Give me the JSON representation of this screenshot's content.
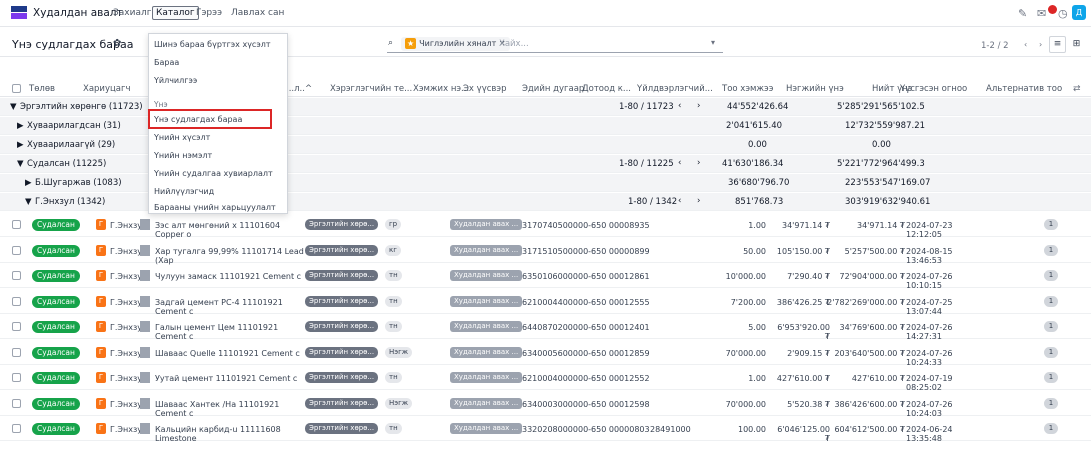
{
  "topbar": {
    "app_name": "Худалдан авалт",
    "menus": [
      "Захиалга",
      "Каталог",
      "Гэрээ",
      "Лавлах сан"
    ],
    "icons": [
      "edit-icon",
      "chat-icon",
      "clock-icon"
    ],
    "user_initial": "Д"
  },
  "subbar": {
    "title": "Үнэ судлагдах бараа",
    "gear": "✿",
    "search_chip": "Чиглэлийн хяналт",
    "search_placeholder": "Хайх...",
    "pager": "1-2 / 2"
  },
  "dropdown": {
    "items_top": [
      "Шинэ бараа бүртгэх хүсэлт",
      "Бараа",
      "Үйлчилгээ"
    ],
    "section": "Үнэ",
    "items_price": [
      "Үнэ судлагдах бараа",
      "Үнийн хүсэлт",
      "Үнийн нэмэлт",
      "Үнийн судалгаа хувиарлалт",
      "Нийлүүлэгчид",
      "Барааны үнийн харьцуулалт"
    ]
  },
  "columns": [
    "Төлөв",
    "Хариуцагч",
    "...л..^",
    "Хэрэглэгчийн те...",
    "Хэмжих нэ...",
    "Эх үүсвэр",
    "Эдийн дугаар",
    "Дотоод к...",
    "Үйлдвэрлэгчий...",
    "Тоо хэмжээ",
    "Нэгжийн үнэ",
    "Нийт үнэ",
    "Үүсгэсэн огноо",
    "Альтернатив тоо"
  ],
  "groups": [
    {
      "label": "Эргэлтийн хөрөнгө (11723)",
      "arrow": "▼",
      "pager": "1-80 / 11723",
      "qty": "44'552'426.64",
      "total": "5'285'291'565'102.5"
    },
    {
      "label": "Хуваарилагдсан (31)",
      "arrow": "▶",
      "qty": "2'041'615.40",
      "total": "12'732'559'987.21"
    },
    {
      "label": "Хуваарилаагүй (29)",
      "arrow": "▶",
      "qty": "0.00",
      "total": "0.00"
    },
    {
      "label": "Судалсан (11225)",
      "arrow": "▼",
      "pager": "1-80 / 11225",
      "qty": "41'630'186.34",
      "total": "5'221'772'964'499.3"
    },
    {
      "label": "Б.Шугаржав (1083)",
      "arrow": "▶",
      "qty": "36'680'796.70",
      "total": "223'553'547'169.07"
    },
    {
      "label": "Г.Энхзул (1342)",
      "arrow": "▼",
      "pager": "1-80 / 1342",
      "qty": "851'768.73",
      "total": "303'919'632'940.61"
    }
  ],
  "rows": [
    {
      "status": "Судалсан",
      "user": "Г.Энхзул",
      "product": "Зэс алт мөнгөний х 11101604 Copper o",
      "tag": "Эргэлтийн хөрө...",
      "unit": "гр",
      "source": "Худалдан авах ...",
      "code": "3170740500000-650 00008935",
      "mfr": "",
      "qty": "1.00",
      "price": "34'971.14 ₮",
      "total": "34'971.14 ₮",
      "date": "2024-07-23 12:12:05",
      "alt": "1"
    },
    {
      "status": "Судалсан",
      "user": "Г.Энхзул",
      "product": "Хар тугалга 99,99% 11101714 Lead (Хар",
      "tag": "Эргэлтийн хөрө...",
      "unit": "кг",
      "source": "Худалдан авах ...",
      "code": "3171510500000-650 00000899",
      "mfr": "",
      "qty": "50.00",
      "price": "105'150.00 ₮",
      "total": "5'257'500.00 ₮",
      "date": "2024-08-15 13:46:53",
      "alt": "1"
    },
    {
      "status": "Судалсан",
      "user": "Г.Энхзул",
      "product": "Чулуун замаск     11101921 Cement c",
      "tag": "Эргэлтийн хөрө...",
      "unit": "тн",
      "source": "Худалдан авах ...",
      "code": "6350106000000-650 00012861",
      "mfr": "",
      "qty": "10'000.00",
      "price": "7'290.40 ₮",
      "total": "72'904'000.00 ₮",
      "date": "2024-07-26 10:10:15",
      "alt": "1"
    },
    {
      "status": "Судалсан",
      "user": "Г.Энхзул",
      "product": "Задгай цемент PC-4 11101921 Cement c",
      "tag": "Эргэлтийн хөрө...",
      "unit": "тн",
      "source": "Худалдан авах ...",
      "code": "6210004400000-650 00012555",
      "mfr": "",
      "qty": "7'200.00",
      "price": "386'426.25 ₮",
      "total": "2'782'269'000.00 ₮",
      "date": "2024-07-25 13:07:44",
      "alt": "1"
    },
    {
      "status": "Судалсан",
      "user": "Г.Энхзул",
      "product": "Галын цемент Цем 11101921 Cement c",
      "tag": "Эргэлтийн хөрө...",
      "unit": "тн",
      "source": "Худалдан авах ...",
      "code": "6440870200000-650 00012401",
      "mfr": "",
      "qty": "5.00",
      "price": "6'953'920.00 ₮",
      "total": "34'769'600.00 ₮",
      "date": "2024-07-26 14:27:31",
      "alt": "1"
    },
    {
      "status": "Судалсан",
      "user": "Г.Энхзул",
      "product": "Шавааc Quelle      11101921 Cement c",
      "tag": "Эргэлтийн хөрө...",
      "unit": "Нэгж",
      "source": "Худалдан авах ...",
      "code": "6340005600000-650 00012859",
      "mfr": "",
      "qty": "70'000.00",
      "price": "2'909.15 ₮",
      "total": "203'640'500.00 ₮",
      "date": "2024-07-26 10:24:33",
      "alt": "1"
    },
    {
      "status": "Судалсан",
      "user": "Г.Энхзул",
      "product": "Уутай цемент       11101921 Cement c",
      "tag": "Эргэлтийн хөрө...",
      "unit": "тн",
      "source": "Худалдан авах ...",
      "code": "6210004000000-650 00012552",
      "mfr": "",
      "qty": "1.00",
      "price": "427'610.00 ₮",
      "total": "427'610.00 ₮",
      "date": "2024-07-19 08:25:02",
      "alt": "1"
    },
    {
      "status": "Судалсан",
      "user": "Г.Энхзул",
      "product": "Шавааc Хантек /На 11101921 Cement c",
      "tag": "Эргэлтийн хөрө...",
      "unit": "Нэгж",
      "source": "Худалдан авах ...",
      "code": "6340003000000-650 00012598",
      "mfr": "",
      "qty": "70'000.00",
      "price": "5'520.38 ₮",
      "total": "386'426'600.00 ₮",
      "date": "2024-07-26 10:24:03",
      "alt": "1"
    },
    {
      "status": "Судалсан",
      "user": "Г.Энхзул",
      "product": "Кальцийн карбид-u 11111608 Limestone",
      "tag": "Эргэлтийн хөрө...",
      "unit": "тн",
      "source": "Худалдан авах ...",
      "code": "3320208000000-650 00000803",
      "mfr": "28491000",
      "qty": "100.00",
      "price": "6'046'125.00 ₮",
      "total": "604'612'500.00 ₮",
      "date": "2024-06-24 13:35:48",
      "alt": "1"
    }
  ]
}
